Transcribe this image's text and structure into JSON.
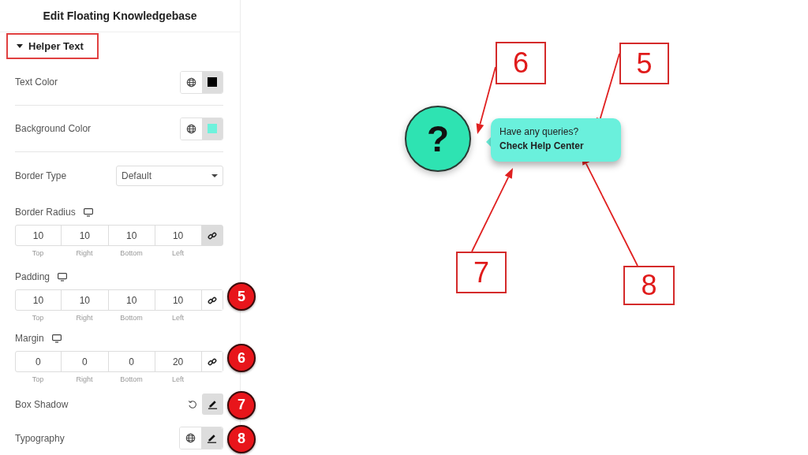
{
  "panel": {
    "title": "Edit Floating Knowledgebase",
    "section": {
      "label": "Helper Text",
      "expanded": true,
      "highlighted": true
    },
    "controls": [
      {
        "kind": "color",
        "label": "Text Color",
        "color": "#000000"
      },
      {
        "kind": "color",
        "label": "Background Color",
        "color": "#6ef2dc"
      },
      {
        "kind": "select",
        "label": "Border Type",
        "value": "Default"
      },
      {
        "kind": "dimensions",
        "label": "Border Radius",
        "linked": true,
        "fields": [
          {
            "value": "10",
            "caption": "Top"
          },
          {
            "value": "10",
            "caption": "Right"
          },
          {
            "value": "10",
            "caption": "Bottom"
          },
          {
            "value": "10",
            "caption": "Left"
          }
        ]
      },
      {
        "kind": "dimensions",
        "label": "Padding",
        "linked": false,
        "badge": "5",
        "fields": [
          {
            "value": "10",
            "caption": "Top"
          },
          {
            "value": "10",
            "caption": "Right"
          },
          {
            "value": "10",
            "caption": "Bottom"
          },
          {
            "value": "10",
            "caption": "Left"
          }
        ]
      },
      {
        "kind": "dimensions",
        "label": "Margin",
        "linked": false,
        "badge": "6",
        "fields": [
          {
            "value": "0",
            "caption": "Top"
          },
          {
            "value": "0",
            "caption": "Right"
          },
          {
            "value": "0",
            "caption": "Bottom"
          },
          {
            "value": "20",
            "caption": "Left"
          }
        ]
      },
      {
        "kind": "popover",
        "label": "Box Shadow",
        "badge": "7"
      },
      {
        "kind": "typography",
        "label": "Typography",
        "badge": "8"
      }
    ]
  },
  "preview": {
    "button_glyph": "?",
    "bubble": {
      "line_1": "Have any queries?",
      "line_2": "Check Help Center"
    },
    "callouts": [
      {
        "number": "6"
      },
      {
        "number": "5"
      },
      {
        "number": "7"
      },
      {
        "number": "8"
      }
    ]
  }
}
